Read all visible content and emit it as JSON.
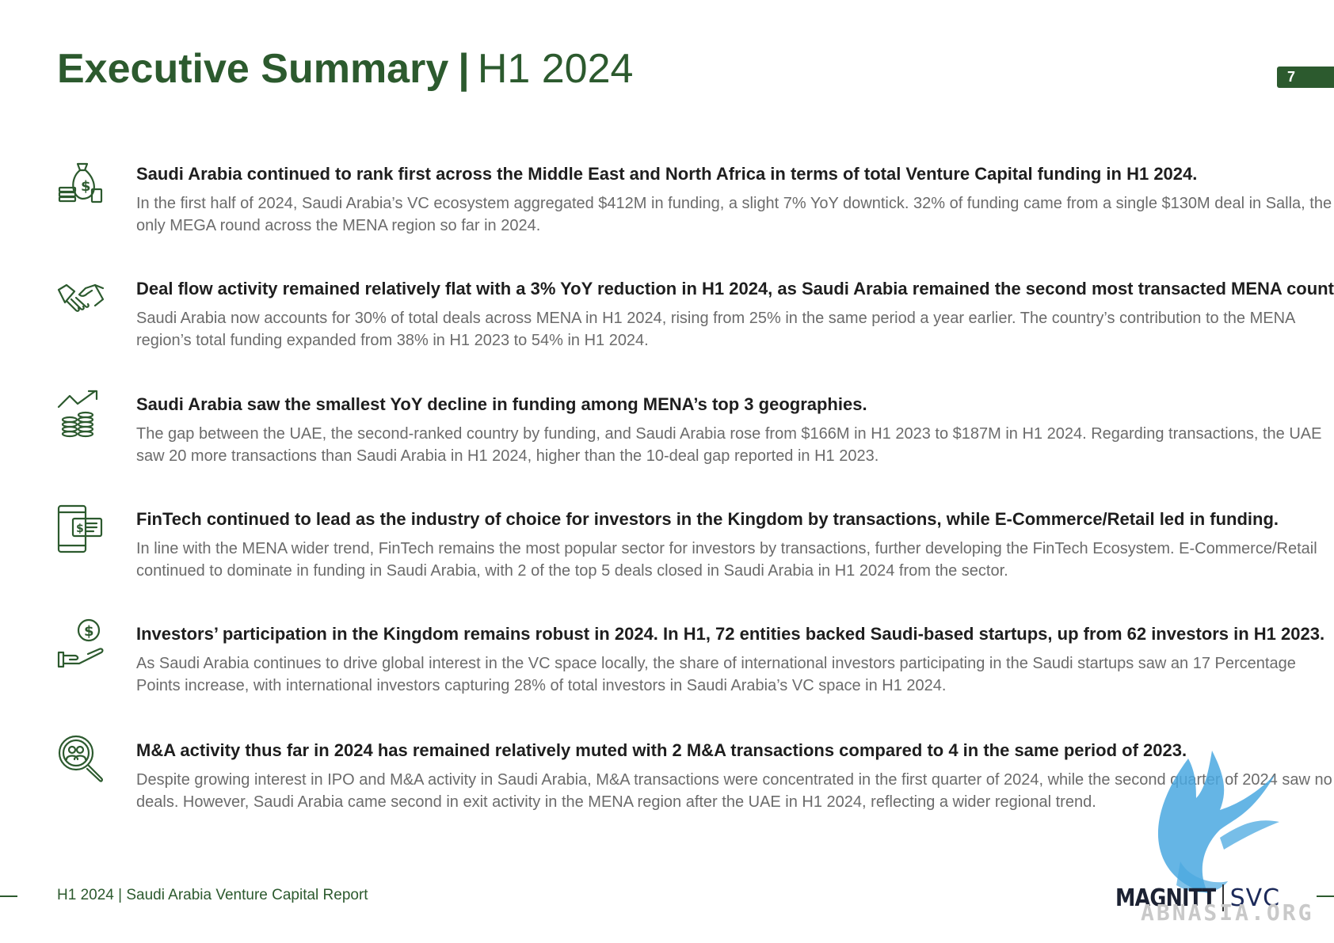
{
  "header": {
    "title_bold": "Executive Summary",
    "separator": "|",
    "title_light": "H1 2024",
    "page_number": "7"
  },
  "items": [
    {
      "icon": "money-bag-icon",
      "heading": "Saudi Arabia continued to rank first across the Middle East and North Africa in terms of total Venture Capital funding in H1 2024.",
      "body": "In the first half of 2024, Saudi Arabia’s VC ecosystem aggregated $412M in funding, a slight 7% YoY downtick. 32% of funding came from a single $130M deal in Salla, the only MEGA round across the MENA region so far in 2024."
    },
    {
      "icon": "handshake-icon",
      "heading": "Deal flow activity remained relatively flat with a 3% YoY reduction in H1 2024, as Saudi Arabia remained the second most transacted MENA country.",
      "body": "Saudi Arabia now accounts for 30% of total deals across MENA in H1 2024, rising from 25% in the same period a year earlier. The country’s contribution to the MENA region’s total funding expanded from 38% in H1 2023 to 54% in H1 2024."
    },
    {
      "icon": "coins-growth-icon",
      "heading": "Saudi Arabia saw the smallest YoY decline in funding among  MENA’s top 3 geographies.",
      "body": "The gap between the UAE, the second-ranked country by funding, and Saudi Arabia rose from $166M in H1 2023 to $187M in H1 2024. Regarding transactions, the UAE saw 20 more transactions than Saudi Arabia in H1 2024, higher than the 10-deal gap reported in H1 2023."
    },
    {
      "icon": "mobile-payment-icon",
      "heading": "FinTech continued to lead as the industry of choice for investors in the Kingdom by transactions, while E-Commerce/Retail led in funding.",
      "body": "In line with the MENA wider trend, FinTech remains the most popular sector for investors by transactions, further developing the FinTech Ecosystem. E-Commerce/Retail continued to dominate in funding in Saudi Arabia, with 2 of the top 5 deals closed in Saudi Arabia in H1 2024 from the sector."
    },
    {
      "icon": "hand-dollar-icon",
      "heading": "Investors’ participation in the Kingdom remains robust in 2024. In H1, 72 entities backed Saudi-based startups, up from 62 investors in H1 2023.",
      "body": "As Saudi Arabia continues to drive global interest in the VC space locally, the share of international investors participating in the Saudi startups saw an 17 Percentage Points increase, with international investors capturing 28% of total investors in Saudi Arabia’s VC space in H1 2024."
    },
    {
      "icon": "people-search-icon",
      "heading": "M&A activity thus far in 2024 has remained relatively muted with 2 M&A transactions compared to 4 in the same period of 2023.",
      "body": "Despite growing interest in IPO and M&A activity in Saudi Arabia, M&A transactions were concentrated in the first quarter of 2024, while the second quarter of 2024 saw no deals. However, Saudi Arabia came second in exit activity in the MENA region after the UAE in H1 2024, reflecting a wider regional trend."
    }
  ],
  "footer": {
    "report_name": "H1 2024 | Saudi Arabia Venture Capital Report",
    "logo_magnitt": "MAGNITT",
    "logo_svc": "SVC",
    "watermark": "ABNASIA.ORG"
  },
  "colors": {
    "brand_green": "#2c5a2e",
    "heading_text": "#1e1e1e",
    "body_text": "#6b6b6b",
    "watermark_blue": "#4aa8e0"
  }
}
